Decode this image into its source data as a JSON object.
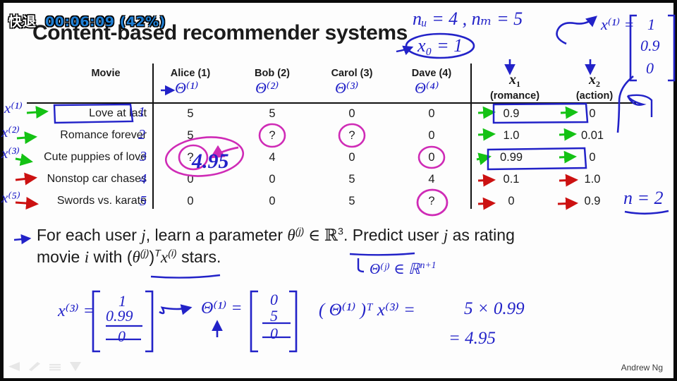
{
  "osd": {
    "rewind_label": "快退",
    "time_label": "00:06:09 (42%)",
    "time_color": "#1f7fd4"
  },
  "slide": {
    "title": "Content-based recommender systems",
    "credit": "Andrew Ng"
  },
  "table": {
    "headers": {
      "movie": "Movie",
      "users": [
        "Alice (1)",
        "Bob (2)",
        "Carol (3)",
        "Dave (4)"
      ],
      "features": [
        {
          "symbol": "x",
          "subscript": "1",
          "name": "(romance)"
        },
        {
          "symbol": "x",
          "subscript": "2",
          "name": "(action)"
        }
      ]
    },
    "rows": [
      {
        "index": "1",
        "movie": "Love at last",
        "ratings": [
          "5",
          "5",
          "0",
          "0"
        ],
        "x1": "0.9",
        "x2": "0"
      },
      {
        "index": "2",
        "movie": "Romance forever",
        "ratings": [
          "5",
          "?",
          "?",
          "0"
        ],
        "x1": "1.0",
        "x2": "0.01"
      },
      {
        "index": "3",
        "movie": "Cute puppies of love",
        "ratings": [
          "?",
          "4",
          "0",
          "0"
        ],
        "x1": "0.99",
        "x2": "0"
      },
      {
        "index": "4",
        "movie": "Nonstop car chases",
        "ratings": [
          "0",
          "0",
          "5",
          "4"
        ],
        "x1": "0.1",
        "x2": "1.0"
      },
      {
        "index": "5",
        "movie": "Swords vs. karate",
        "ratings": [
          "0",
          "0",
          "5",
          "?"
        ],
        "x1": "0",
        "x2": "0.9"
      }
    ]
  },
  "body": {
    "line1_a": "For each user ",
    "line1_j": "j",
    "line1_b": ", learn a parameter ",
    "line1_theta": "θ",
    "line1_theta_sup": "(j)",
    "line1_in": " ∈ ℝ",
    "line1_dim": "3",
    "line1_c": ". Predict user ",
    "line1_j2": "j",
    "line1_d": " as rating",
    "line2_a": "movie ",
    "line2_i": "i",
    "line2_b": " with (",
    "line2_theta": "θ",
    "line2_theta_sup": "(j)",
    "line2_t": ")",
    "line2_tsup": "T",
    "line2_x": "x",
    "line2_xsup": "(i)",
    "line2_c": " stars."
  },
  "annotations": {
    "n_counts": "nᵤ = 4 ,  nₘ = 5",
    "x0": "x₀ = 1",
    "x1_vector": {
      "label": "x⁽¹⁾ =",
      "entries": [
        "1",
        "0.9",
        "0"
      ]
    },
    "n_equals": "n = 2",
    "theta_col_1": "Θ⁽¹⁾",
    "theta_col_2": "Θ⁽²⁾",
    "theta_col_3": "Θ⁽³⁾",
    "theta_col_4": "Θ⁽⁴⁾",
    "row_x_labels": [
      "x⁽¹⁾",
      "x⁽²⁾",
      "x⁽³⁾",
      "",
      "x⁽⁵⁾"
    ],
    "prediction_value": "4.95",
    "theta_in_rn1": "Θ⁽ʲ⁾ ∈ ℝ",
    "theta_in_rn1_sup": "n+1",
    "bottom_x3": {
      "label": "x⁽³⁾ =",
      "entries": [
        "1",
        "0.99",
        "0"
      ]
    },
    "bottom_theta1": {
      "label": "Θ⁽¹⁾ =",
      "entries": [
        "0",
        "5",
        "0"
      ]
    },
    "bottom_product_label": "( Θ⁽¹⁾ )ᵀ x⁽³⁾  =",
    "bottom_product_rhs1": "5 × 0.99",
    "bottom_product_rhs2": "= 4.95"
  },
  "colors": {
    "ink_blue": "#2222c8",
    "ink_magenta": "#cf2bb6",
    "ink_green": "#14c214",
    "ink_red": "#cc1111",
    "text": "#1b1b1b"
  },
  "toolbar": {
    "icons": [
      "back-arrow-icon",
      "pen-icon",
      "menu-icon",
      "down-arrow-icon"
    ]
  }
}
